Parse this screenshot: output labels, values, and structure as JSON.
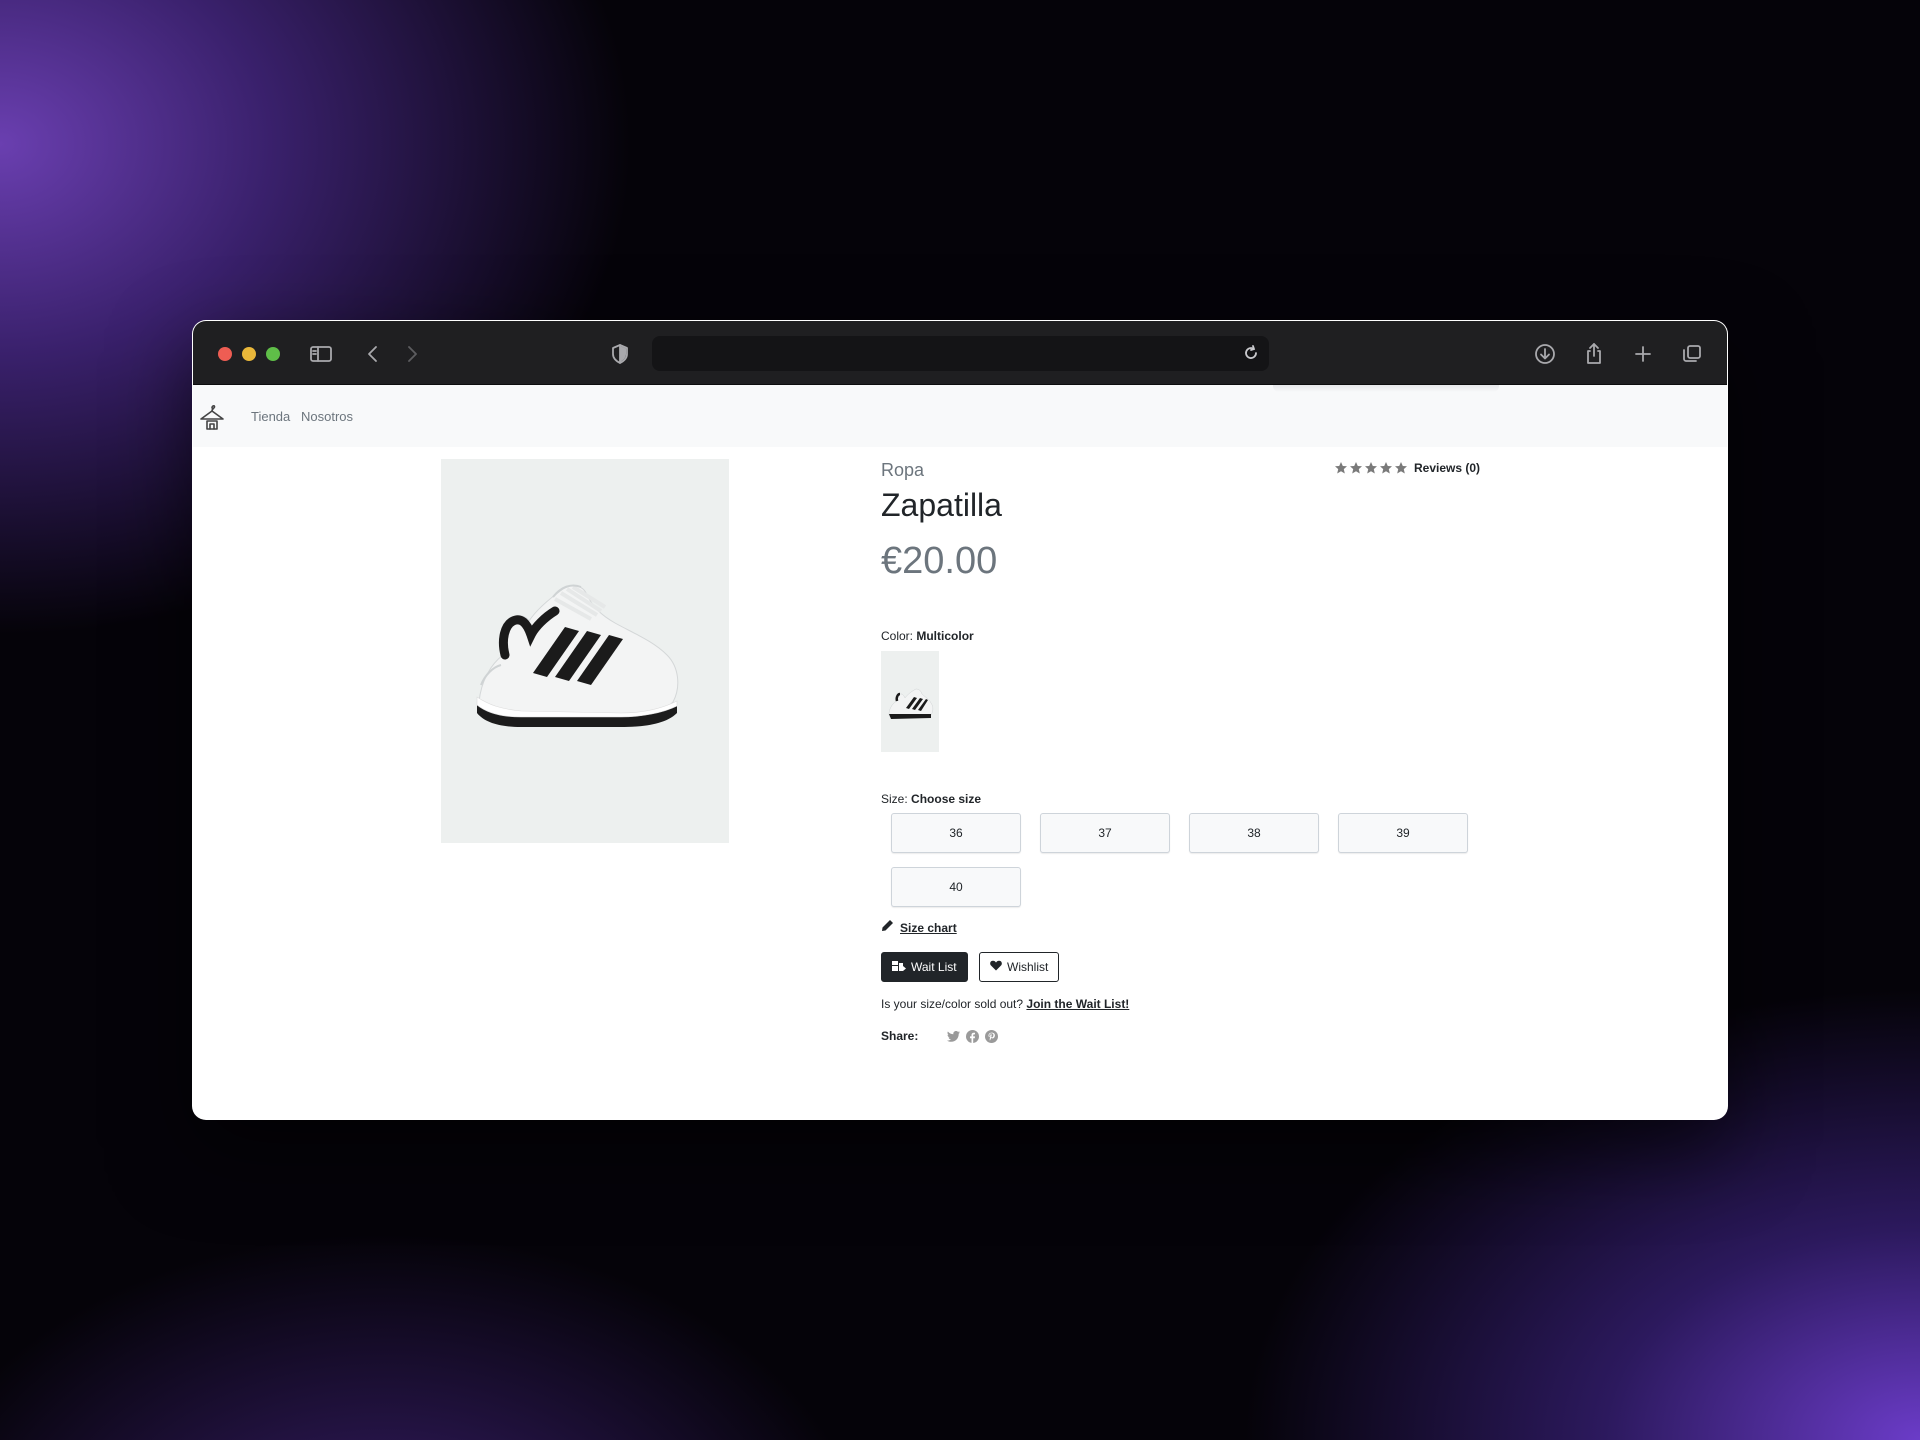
{
  "browser": {
    "url": "",
    "icons": [
      "sidebar-icon",
      "back-icon",
      "forward-icon",
      "shield-icon",
      "reload-icon",
      "download-icon",
      "share-icon",
      "new-tab-icon",
      "tabs-overview-icon"
    ]
  },
  "navbar": {
    "logo_icon": "hanger-shop-icon",
    "links": [
      "Tienda",
      "Nosotros"
    ]
  },
  "product": {
    "category": "Ropa",
    "name": "Zapatilla",
    "price": "€20.00",
    "rating_stars": 5,
    "reviews_label": "Reviews (0)",
    "color_label": "Color:",
    "color_value": "Multicolor",
    "size_label": "Size:",
    "size_value": "Choose size",
    "sizes": [
      "36",
      "37",
      "38",
      "39",
      "40"
    ],
    "size_chart_label": "Size chart",
    "wait_list_button": "Wait List",
    "wishlist_button": "Wishlist",
    "soldout_text": "Is your size/color sold out?",
    "soldout_link": "Join the Wait List!",
    "share_label": "Share:",
    "share_icons": [
      "twitter-icon",
      "facebook-icon",
      "pinterest-icon"
    ]
  },
  "colors": {
    "toolbar_bg": "#1f1f21",
    "nav_bg": "#f8f9fa",
    "text": "#212529",
    "muted": "#6c757d",
    "image_bg": "#edf0ef"
  }
}
